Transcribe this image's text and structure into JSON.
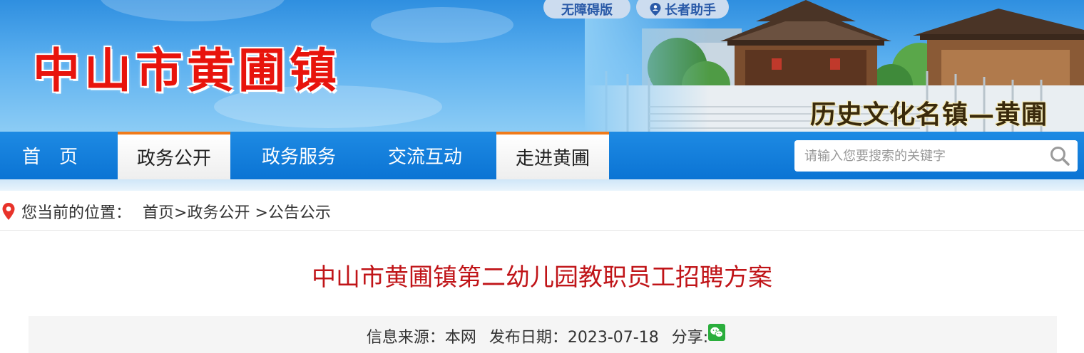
{
  "header": {
    "site_title": "中山市黄圃镇",
    "slogan": "历史文化名镇—黄圃",
    "accessibility": {
      "barrier_free_label": "无障碍版",
      "elderly_label": "长者助手",
      "elderly_icon": "location-person-icon"
    }
  },
  "nav": {
    "items": [
      {
        "label": "首页",
        "active": false
      },
      {
        "label": "政务公开",
        "active": true
      },
      {
        "label": "政务服务",
        "active": false
      },
      {
        "label": "交流互动",
        "active": false
      },
      {
        "label": "走进黄圃",
        "active": true
      }
    ],
    "accent_color": "#0b74d4",
    "active_top_color": "#f07a1a"
  },
  "search": {
    "placeholder": "请输入您要搜索的关键字",
    "value": "",
    "icon": "search-icon"
  },
  "breadcrumb": {
    "icon": "map-pin-icon",
    "label": "您当前的位置：",
    "items": [
      "首页",
      ">政务公开",
      " >公告公示"
    ]
  },
  "article": {
    "title": "中山市黄圃镇第二幼儿园教职员工招聘方案",
    "title_color": "#c01418",
    "source_text": "信息来源：本网",
    "date_text": "发布日期：2023-07-18",
    "share_label": "分享:",
    "share_icon": "wechat-icon"
  }
}
